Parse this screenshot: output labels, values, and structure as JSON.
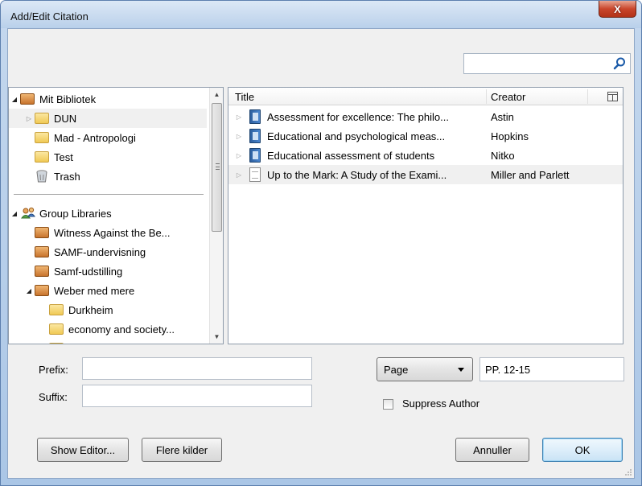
{
  "window": {
    "title": "Add/Edit Citation",
    "close_label": "X"
  },
  "search": {
    "value": "",
    "placeholder": ""
  },
  "tree": {
    "mit_bibliotek": "Mit Bibliotek",
    "items": [
      {
        "label": "DUN",
        "icon": "folder-icon"
      },
      {
        "label": "Mad - Antropologi",
        "icon": "folder-icon"
      },
      {
        "label": "Test",
        "icon": "folder-icon"
      },
      {
        "label": "Trash",
        "icon": "trash-icon"
      }
    ],
    "group_libraries": "Group Libraries",
    "groups": [
      {
        "label": "Witness Against the Be..."
      },
      {
        "label": "SAMF-undervisning"
      },
      {
        "label": "Samf-udstilling"
      },
      {
        "label": "Weber med mere"
      }
    ],
    "subfolders": [
      {
        "label": "Durkheim"
      },
      {
        "label": "economy and society..."
      }
    ]
  },
  "list": {
    "columns": {
      "title": "Title",
      "creator": "Creator"
    },
    "rows": [
      {
        "title": "Assessment for excellence: The philo...",
        "creator": "Astin",
        "icon": "book-icon"
      },
      {
        "title": "Educational and psychological meas...",
        "creator": "Hopkins",
        "icon": "book-icon"
      },
      {
        "title": "Educational assessment of students",
        "creator": "Nitko",
        "icon": "book-icon"
      },
      {
        "title": "Up to the Mark: A Study of the Exami...",
        "creator": "Miller and Parlett",
        "icon": "document-icon"
      }
    ]
  },
  "form": {
    "prefix_label": "Prefix:",
    "prefix_value": "",
    "suffix_label": "Suffix:",
    "suffix_value": "",
    "locator_type": "Page",
    "locator_value": "PP. 12-15",
    "suppress_author_label": "Suppress Author",
    "suppress_author_checked": false
  },
  "buttons": {
    "show_editor": "Show Editor...",
    "flere_kilder": "Flere kilder",
    "annuller": "Annuller",
    "ok": "OK"
  }
}
